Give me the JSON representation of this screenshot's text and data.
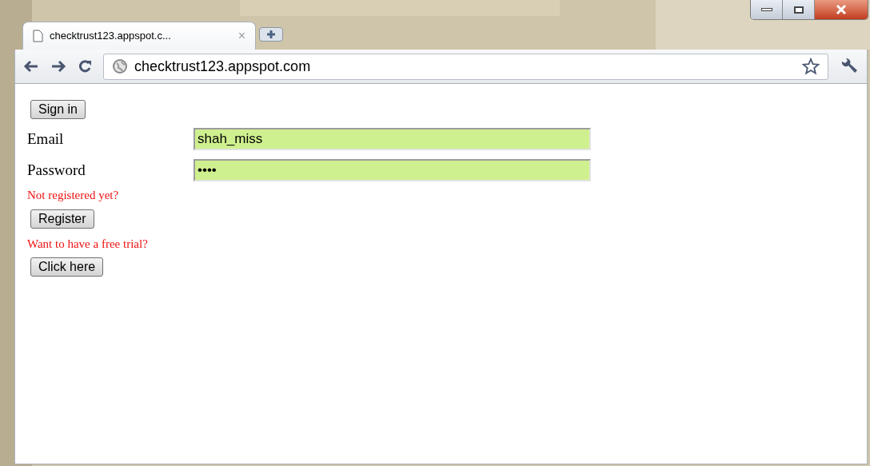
{
  "tab": {
    "title": "checktrust123.appspot.c...",
    "close": "×"
  },
  "address_bar": {
    "url": "checktrust123.appspot.com"
  },
  "page": {
    "sign_in_button": "Sign in",
    "fields": [
      {
        "label": "Email",
        "value": "shah_miss"
      },
      {
        "label": "Password",
        "value": "••••"
      }
    ],
    "register_prompt": "Not registered yet?",
    "register_button": "Register",
    "trial_prompt": "Want to have a free trial?",
    "trial_button": "Click here"
  }
}
